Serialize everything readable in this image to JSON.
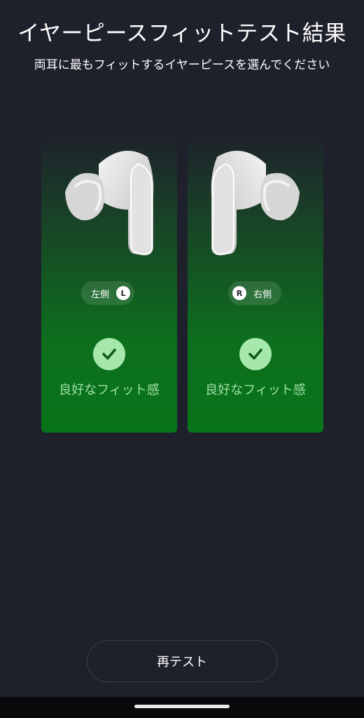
{
  "header": {
    "title": "イヤーピースフィットテスト結果",
    "subtitle": "両耳に最もフィットするイヤーピースを選んでください"
  },
  "cards": [
    {
      "side_label": "左側",
      "badge": "L",
      "result": "良好なフィット感",
      "icon": "check-icon",
      "earbud_icon": "left-earbud-image"
    },
    {
      "side_label": "右側",
      "badge": "R",
      "result": "良好なフィット感",
      "icon": "check-icon",
      "earbud_icon": "right-earbud-image"
    }
  ],
  "actions": {
    "retest_label": "再テスト"
  },
  "colors": {
    "background": "#1e202b",
    "card_green": "#0d6f1d",
    "check_circle": "#a6e8ac",
    "result_text": "#9fe0a5"
  }
}
